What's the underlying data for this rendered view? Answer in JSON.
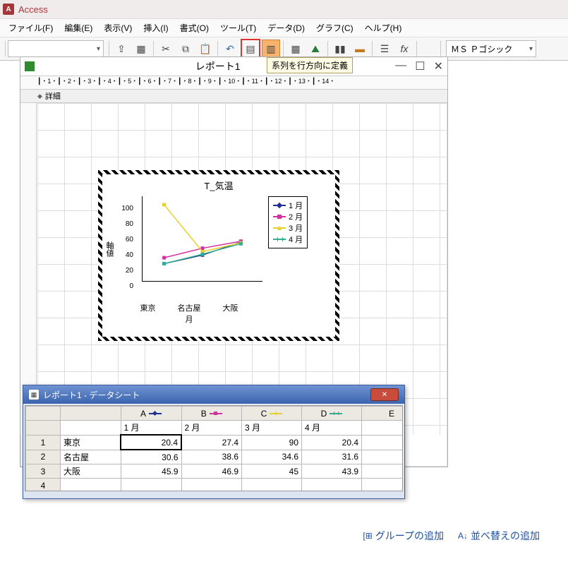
{
  "app": {
    "name": "Access"
  },
  "menu": [
    "ファイル(F)",
    "編集(E)",
    "表示(V)",
    "挿入(I)",
    "書式(O)",
    "ツール(T)",
    "データ(D)",
    "グラフ(C)",
    "ヘルプ(H)"
  ],
  "toolbar": {
    "font_name": "ＭＳ Ｐゴシック",
    "tooltip": "系列を行方向に定義"
  },
  "report": {
    "title": "レポート1",
    "section_label": "詳細",
    "ruler_h": "┃・1・┃・2・┃・3・┃・4・┃・5・┃・6・┃・7・┃・8・┃・9・┃・10・┃・11・┃・12・┃・13・┃・14・"
  },
  "datasheet": {
    "title": "レポート1 - データシート",
    "col_letters": [
      "A",
      "B",
      "C",
      "D",
      "E"
    ],
    "col_headers": [
      "1 月",
      "2 月",
      "3 月",
      "4 月",
      ""
    ],
    "rows": [
      {
        "n": "1",
        "label": "東京",
        "cells": [
          "20.4",
          "27.4",
          "90",
          "20.4"
        ]
      },
      {
        "n": "2",
        "label": "名古屋",
        "cells": [
          "30.6",
          "38.6",
          "34.6",
          "31.6"
        ]
      },
      {
        "n": "3",
        "label": "大阪",
        "cells": [
          "45.9",
          "46.9",
          "45",
          "43.9"
        ]
      },
      {
        "n": "4",
        "label": "",
        "cells": [
          "",
          "",
          "",
          ""
        ]
      }
    ]
  },
  "chart_data": {
    "type": "line",
    "title": "T_気温",
    "xlabel": "月",
    "ylabel": "軸値",
    "ylim": [
      0,
      100
    ],
    "yticks": [
      0,
      20,
      40,
      60,
      80,
      100
    ],
    "categories": [
      "東京",
      "名古屋",
      "大阪"
    ],
    "series": [
      {
        "name": "1 月",
        "color": "#203090",
        "values": [
          20.4,
          30.6,
          45.9
        ]
      },
      {
        "name": "2 月",
        "color": "#d030a0",
        "values": [
          27.4,
          38.6,
          46.9
        ]
      },
      {
        "name": "3 月",
        "color": "#e8d030",
        "values": [
          90,
          34.6,
          45
        ]
      },
      {
        "name": "4 月",
        "color": "#30b090",
        "values": [
          20.4,
          31.6,
          43.9
        ]
      }
    ]
  },
  "bottom": {
    "group_add": "グループの追加",
    "sort_add": "並べ替えの追加"
  }
}
